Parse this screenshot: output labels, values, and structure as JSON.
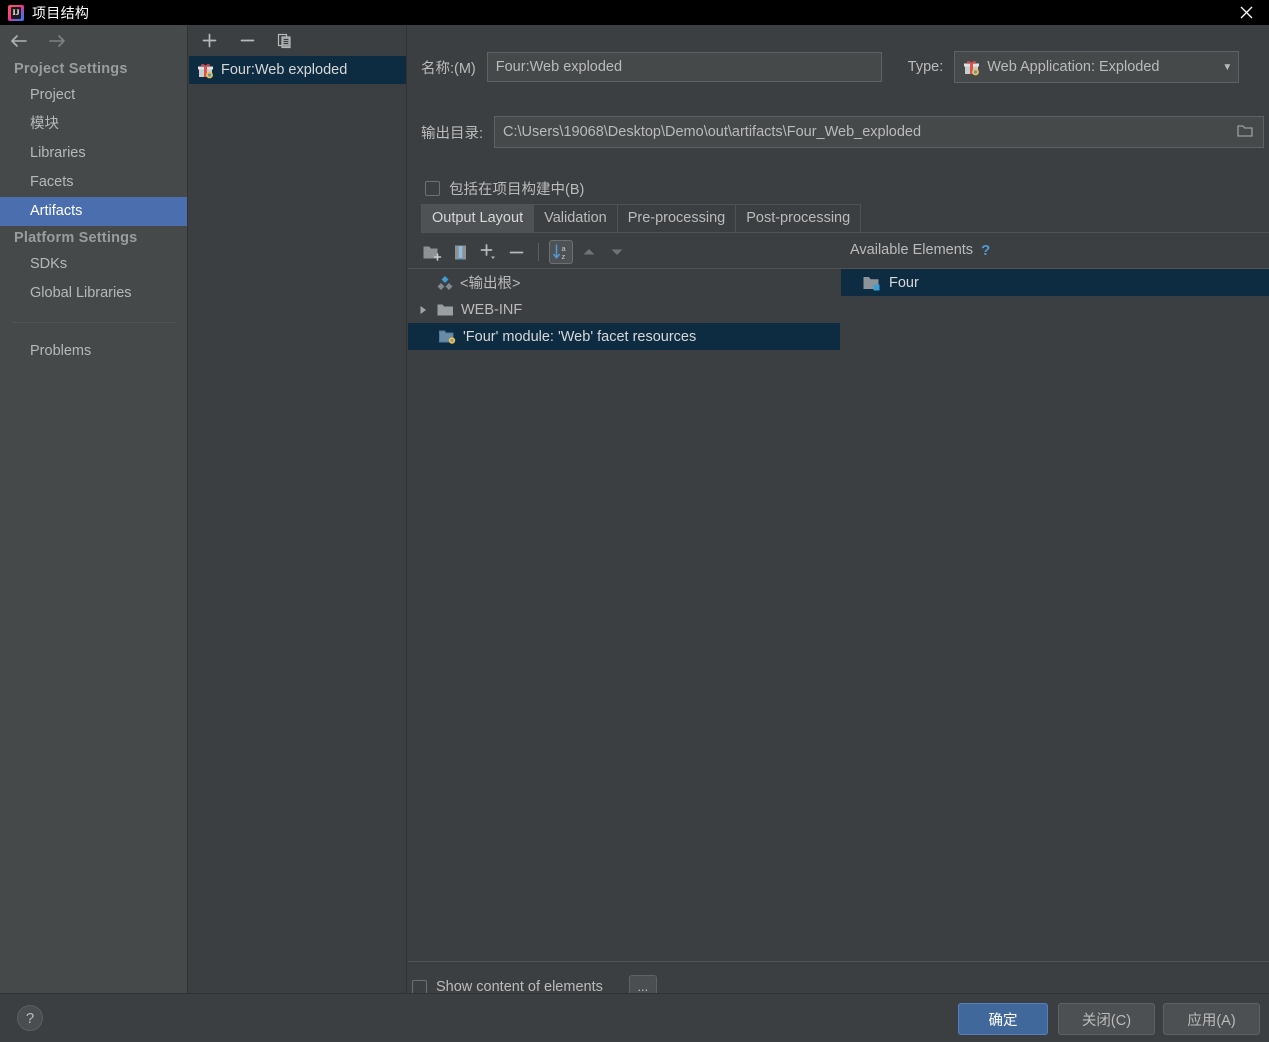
{
  "window": {
    "title": "项目结构",
    "app_icon": "intellij-idea-icon",
    "close_label": "✕"
  },
  "sidebar": {
    "back_icon": "back-arrow-icon",
    "forward_icon": "forward-arrow-icon",
    "groups": [
      {
        "title": "Project Settings",
        "items": [
          {
            "label": "Project",
            "selected": false
          },
          {
            "label": "模块",
            "selected": false
          },
          {
            "label": "Libraries",
            "selected": false
          },
          {
            "label": "Facets",
            "selected": false
          },
          {
            "label": "Artifacts",
            "selected": true
          }
        ]
      },
      {
        "title": "Platform Settings",
        "items": [
          {
            "label": "SDKs",
            "selected": false
          },
          {
            "label": "Global Libraries",
            "selected": false
          }
        ]
      }
    ],
    "problems_label": "Problems"
  },
  "artifacts_panel": {
    "toolbar": [
      {
        "name": "add-artifact-button",
        "glyph": "+"
      },
      {
        "name": "remove-artifact-button",
        "glyph": "−"
      },
      {
        "name": "copy-artifact-button",
        "glyph": "copy-icon"
      }
    ],
    "items": [
      {
        "label": "Four:Web exploded",
        "icon": "artifact-gift-icon",
        "selected": true
      }
    ]
  },
  "main": {
    "name_label": "名称:(M)",
    "name_value": "Four:Web exploded",
    "type_label": "Type:",
    "type_value": "Web Application: Exploded",
    "type_icon": "artifact-gift-icon",
    "output_dir_label": "输出目录:",
    "output_dir_value": "C:\\Users\\19068\\Desktop\\Demo\\out\\artifacts\\Four_Web_exploded",
    "browse_icon": "folder-browse-icon",
    "include_in_build_label": "包括在项目构建中(B)",
    "include_in_build_checked": false,
    "tabs": [
      {
        "label": "Output Layout",
        "active": true
      },
      {
        "label": "Validation",
        "active": false
      },
      {
        "label": "Pre-processing",
        "active": false
      },
      {
        "label": "Post-processing",
        "active": false
      }
    ],
    "element_toolbar": [
      {
        "name": "create-directory-button",
        "icon": "new-folder-icon",
        "active": false
      },
      {
        "name": "create-archive-button",
        "icon": "archive-jar-icon",
        "active": false
      },
      {
        "name": "add-copy-of-button",
        "icon": "plus-dropdown-icon",
        "active": false
      },
      {
        "name": "remove-element-button",
        "icon": "minus-icon",
        "active": false
      },
      {
        "name": "sort-elements-button",
        "icon": "sort-az-icon",
        "active": true
      },
      {
        "name": "move-up-button",
        "icon": "arrow-up-icon",
        "active": false
      },
      {
        "name": "move-down-button",
        "icon": "arrow-down-icon",
        "active": false
      }
    ],
    "output_tree": [
      {
        "label": "<输出根>",
        "icon": "output-root-icon",
        "depth": 0,
        "expandable": false,
        "selected": false
      },
      {
        "label": "WEB-INF",
        "icon": "folder-icon",
        "depth": 0,
        "expandable": true,
        "expanded": false,
        "selected": false
      },
      {
        "label": "'Four' module: 'Web' facet resources",
        "icon": "facet-resources-icon",
        "depth": 1,
        "expandable": false,
        "selected": true
      }
    ],
    "available_elements_title": "Available Elements",
    "available_elements_help": "?",
    "available_elements": [
      {
        "label": "Four",
        "icon": "module-folder-icon",
        "selected": true
      }
    ],
    "show_content_label": "Show content of elements",
    "show_content_checked": false,
    "dots_button_label": "..."
  },
  "footer": {
    "help_label": "?",
    "buttons": [
      {
        "name": "ok-button",
        "label": "确定",
        "primary": true
      },
      {
        "name": "close-button",
        "label": "关闭(C)",
        "primary": false,
        "mnemonic": "C"
      },
      {
        "name": "apply-button",
        "label": "应用(A)",
        "primary": false,
        "mnemonic": "A"
      }
    ]
  },
  "colors": {
    "window_bg": "#3c3f41",
    "sidebar_bg": "#45494a",
    "sidebar_selection": "#4b6eaf",
    "tree_selection": "#0d2c42",
    "accent_blue": "#4e9ad4",
    "primary_button": "#41689b",
    "text": "#bbbbbb",
    "titlebar_bg": "#000000"
  }
}
